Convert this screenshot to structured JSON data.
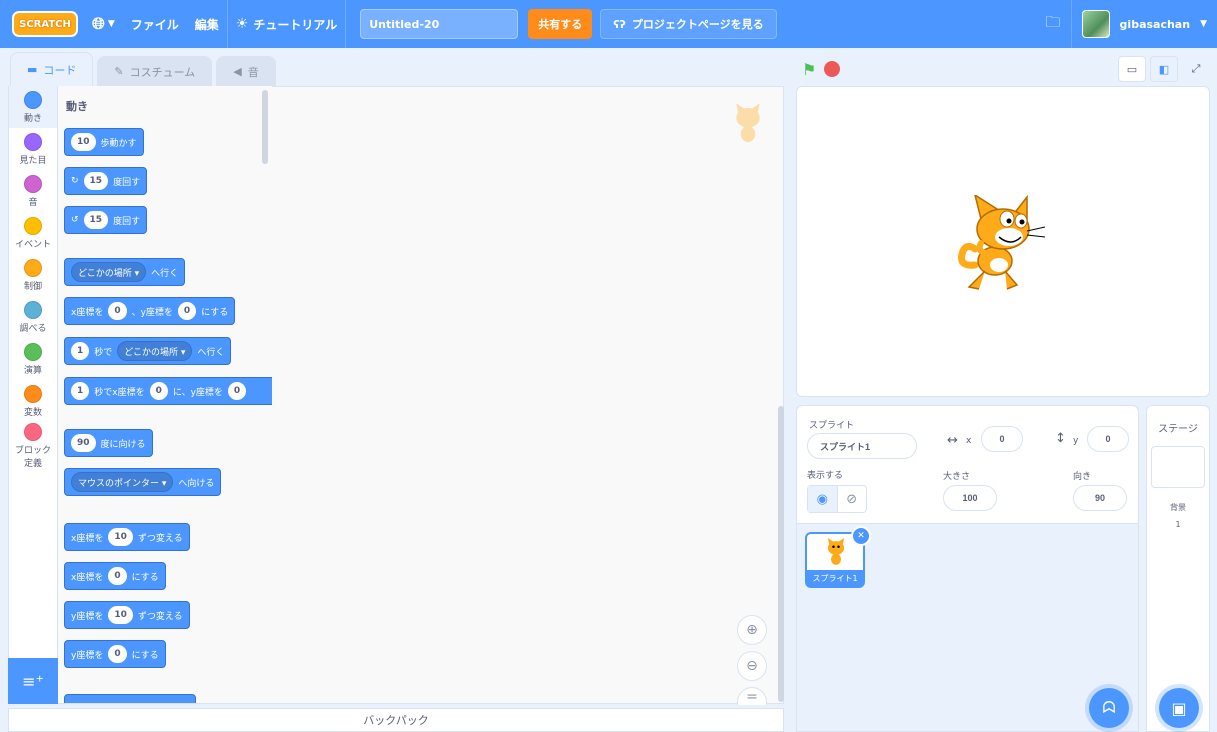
{
  "menubar": {
    "logo": "SCRATCH",
    "file": "ファイル",
    "edit": "編集",
    "tutorial": "チュートリアル",
    "project_title": "Untitled-20",
    "share": "共有する",
    "see_project": "プロジェクトページを見る",
    "username": "gibasachan"
  },
  "tabs": {
    "code": "コード",
    "costumes": "コスチューム",
    "sounds": "音"
  },
  "categories": [
    {
      "label": "動き",
      "color": "#4c97ff"
    },
    {
      "label": "見た目",
      "color": "#9966ff"
    },
    {
      "label": "音",
      "color": "#cf63cf"
    },
    {
      "label": "イベント",
      "color": "#ffbf00"
    },
    {
      "label": "制御",
      "color": "#ffab19"
    },
    {
      "label": "調べる",
      "color": "#5cb1d6"
    },
    {
      "label": "演算",
      "color": "#59c059"
    },
    {
      "label": "変数",
      "color": "#ff8c1a"
    },
    {
      "label": "ブロック定義",
      "color": "#ff6680"
    }
  ],
  "palette": {
    "heading": "動き",
    "blocks": {
      "move_n": "10",
      "move": "歩動かす",
      "turn_right_n": "15",
      "turn_right": "度回す",
      "turn_left_n": "15",
      "turn_left": "度回す",
      "goto_dd": "どこかの場所 ▾",
      "goto": "へ行く",
      "gotoxy_a": "x座標を",
      "gotoxy_x": "0",
      "gotoxy_b": "、y座標を",
      "gotoxy_y": "0",
      "gotoxy_c": "にする",
      "glide_n": "1",
      "glide_a": "秒で",
      "glide_dd": "どこかの場所 ▾",
      "glide_b": "へ行く",
      "glidexy_n": "1",
      "glidexy_a": "秒でx座標を",
      "glidexy_x": "0",
      "glidexy_b": "に、y座標を",
      "glidexy_y": "0",
      "point_n": "90",
      "point": "度に向ける",
      "towards_dd": "マウスのポインター ▾",
      "towards": "へ向ける",
      "changex_a": "x座標を",
      "changex_n": "10",
      "changex_b": "ずつ変える",
      "setx_a": "x座標を",
      "setx_n": "0",
      "setx_b": "にする",
      "changey_a": "y座標を",
      "changey_n": "10",
      "changey_b": "ずつ変える",
      "sety_a": "y座標を",
      "sety_n": "0",
      "sety_b": "にする"
    }
  },
  "backpack": "バックパック",
  "sprite_info": {
    "label_sprite": "スプライト",
    "sprite_name": "スプライト1",
    "x_label": "x",
    "x": "0",
    "y_label": "y",
    "y": "0",
    "show_label": "表示する",
    "size_label": "大きさ",
    "size": "100",
    "direction_label": "向き",
    "direction": "90"
  },
  "sprite_list": [
    {
      "name": "スプライト1"
    }
  ],
  "stage_panel": {
    "title": "ステージ",
    "backdrops_label": "背景",
    "backdrops_count": "1"
  },
  "colors": {
    "accent": "#4c97ff",
    "share": "#ff8c1a",
    "flag": "#4cbf56",
    "stop": "#ec5959"
  }
}
